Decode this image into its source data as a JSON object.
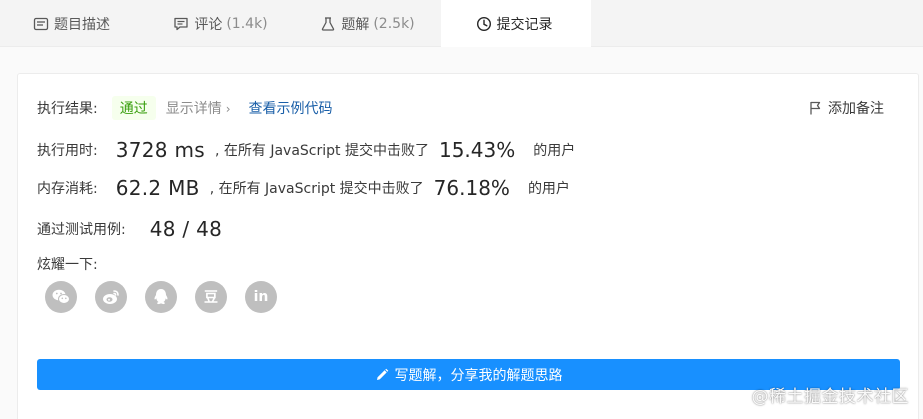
{
  "tabs": [
    {
      "label": "题目描述",
      "count": "",
      "icon": "description-icon",
      "active": false
    },
    {
      "label": "评论",
      "count": "(1.4k)",
      "icon": "comment-icon",
      "active": false
    },
    {
      "label": "题解",
      "count": "(2.5k)",
      "icon": "flask-icon",
      "active": false
    },
    {
      "label": "提交记录",
      "count": "",
      "icon": "clock-icon",
      "active": true
    }
  ],
  "result": {
    "label": "执行结果:",
    "status": "通过",
    "detail_link": "显示详情",
    "sample_link": "查看示例代码",
    "add_note": "添加备注"
  },
  "runtime": {
    "label": "执行用时:",
    "value": "3728 ms",
    "middle": ", 在所有 JavaScript 提交中击败了",
    "percent": "15.43%",
    "suffix": "的用户"
  },
  "memory": {
    "label": "内存消耗:",
    "value": "62.2 MB",
    "middle": ", 在所有 JavaScript 提交中击败了",
    "percent": "76.18%",
    "suffix": "的用户"
  },
  "tests": {
    "label": "通过测试用例:",
    "value": "48 / 48"
  },
  "share": {
    "label": "炫耀一下:",
    "icons": [
      "wechat-icon",
      "weibo-icon",
      "qq-icon",
      "douban-icon",
      "linkedin-icon"
    ],
    "douban_glyph": "豆",
    "linkedin_glyph": "in"
  },
  "write_button": "写题解，分享我的解题思路",
  "watermark": "@稀土掘金技术社区",
  "colors": {
    "accent": "#1890ff",
    "pass_text": "#389e0d",
    "pass_bg": "#f6ffed",
    "link": "#1a5fa8"
  }
}
